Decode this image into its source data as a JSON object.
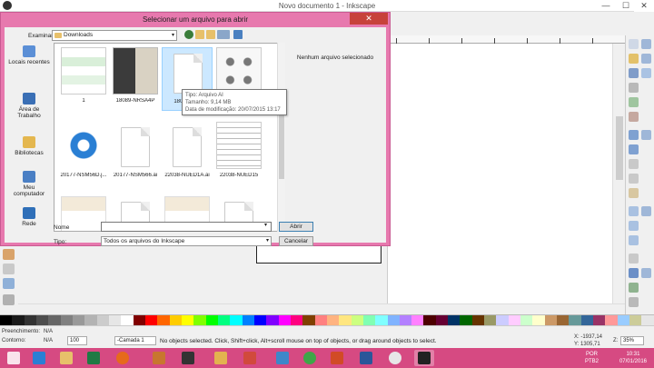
{
  "inkscape": {
    "title": "Novo documento 1 - Inkscape",
    "window_controls": {
      "minimize": "—",
      "maximize": "☐",
      "close": "✕"
    },
    "status": {
      "fill_label": "Preenchimento:",
      "fill_value": "N/A",
      "stroke_label": "Contorno:",
      "stroke_value": "N/A",
      "opacity": "100",
      "layer": "-Camada 1",
      "message": "No objects selected. Click, Shift+click, Alt+scroll mouse on top of objects, or drag around objects to select.",
      "coord_x": "X: -1937,14",
      "coord_y": "Y: 1305,71",
      "zoom_label": "Z:",
      "zoom": "35%"
    },
    "palette": [
      "#000000",
      "#1a1a1a",
      "#333333",
      "#4d4d4d",
      "#666666",
      "#808080",
      "#999999",
      "#b3b3b3",
      "#cccccc",
      "#e6e6e6",
      "#ffffff",
      "#800000",
      "#ff0000",
      "#ff6600",
      "#ffcc00",
      "#ffff00",
      "#80ff00",
      "#00ff00",
      "#00ff80",
      "#00ffff",
      "#0080ff",
      "#0000ff",
      "#8000ff",
      "#ff00ff",
      "#ff0080",
      "#804000",
      "#ff8080",
      "#ffb380",
      "#ffe680",
      "#ccff80",
      "#80ffb3",
      "#80ffff",
      "#80b3ff",
      "#b380ff",
      "#ff80ff",
      "#4d0000",
      "#660033",
      "#003366",
      "#006600",
      "#663300",
      "#999966",
      "#ccccff",
      "#ffccff",
      "#ccffcc",
      "#ffffcc",
      "#cc9966",
      "#996633",
      "#669999",
      "#336699",
      "#993366",
      "#ff9999",
      "#99ccff",
      "#cccc99",
      "#e6e6e6"
    ]
  },
  "dialog": {
    "title": "Selecionar um arquivo para abrir",
    "close": "✕",
    "lookin_label": "Examinar:",
    "lookin_value": "Downloads",
    "places": [
      {
        "label": "Locais recentes",
        "color": "#5b8fd6"
      },
      {
        "label": "Área de Trabalho",
        "color": "#3a6fb5"
      },
      {
        "label": "Bibliotecas",
        "color": "#e4b74f"
      },
      {
        "label": "Meu computador",
        "color": "#4a7fc4"
      },
      {
        "label": "Rede",
        "color": "#2f6fb8"
      }
    ],
    "files": [
      {
        "name": "1"
      },
      {
        "name": "18089-NRSA4P"
      },
      {
        "name": "18089-NRS"
      },
      {
        "name": ""
      },
      {
        "name": "20177-NSM56D.j..."
      },
      {
        "name": "20177-NSM566.ai"
      },
      {
        "name": "22038-NUED1A.ai"
      },
      {
        "name": "22038-NUED15"
      },
      {
        "name": ""
      },
      {
        "name": ""
      },
      {
        "name": ""
      },
      {
        "name": ""
      }
    ],
    "preview_text": "Nenhum arquivo selecionado",
    "tooltip": {
      "type": "Tipo: Arquivo AI",
      "size": "Tamanho: 9,14 MB",
      "date": "Data de modificação: 20/07/2015 13:17"
    },
    "name_label": "Nome",
    "name_value": "",
    "type_label": "Tipo:",
    "type_value": "Todos os arquivos do Inkscape",
    "open_button": "Abrir",
    "cancel_button": "Cancelar"
  },
  "taskbar": {
    "apps": [
      "ie",
      "explorer",
      "excel",
      "firefox",
      "paint",
      "inkscape-tb",
      "chrome",
      "powerpoint",
      "word",
      "media",
      "inkscape-active"
    ],
    "lang_1": "POR",
    "lang_2": "PTB2",
    "time": "10:31",
    "date": "07/01/2016"
  }
}
